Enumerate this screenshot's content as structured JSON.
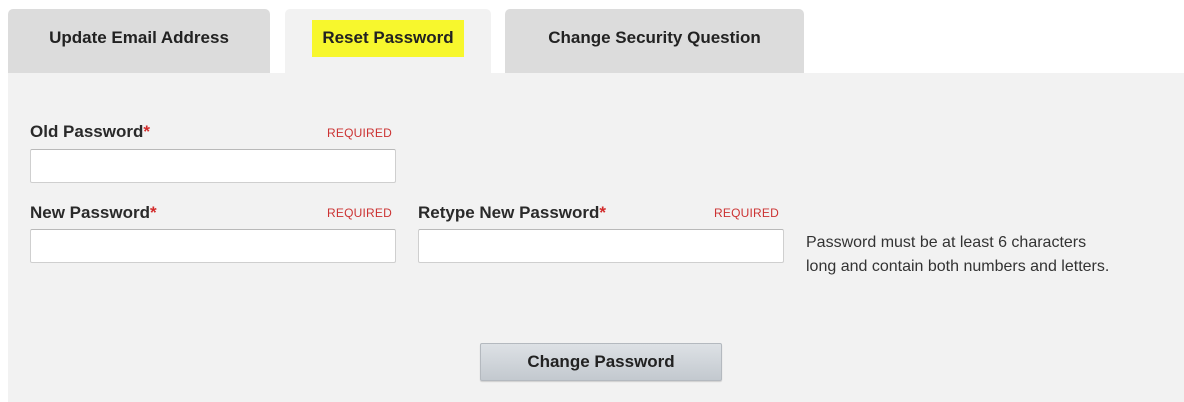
{
  "tabs": [
    {
      "label": "Update Email Address",
      "active": false
    },
    {
      "label": "Reset Password",
      "active": true
    },
    {
      "label": "Change Security Question",
      "active": false
    }
  ],
  "form": {
    "old_password": {
      "label": "Old Password",
      "required_marker": "*",
      "required_tag": "REQUIRED",
      "value": ""
    },
    "new_password": {
      "label": "New Password",
      "required_marker": "*",
      "required_tag": "REQUIRED",
      "value": ""
    },
    "retype_password": {
      "label": "Retype New Password",
      "required_marker": "*",
      "required_tag": "REQUIRED",
      "value": ""
    },
    "hint_line1": "Password must be at least 6 characters",
    "hint_line2": "long and contain both numbers and letters.",
    "submit_label": "Change Password"
  },
  "colors": {
    "panel_background": "#f2f2f2",
    "tab_inactive": "#dcdcdc",
    "active_highlight": "#f7f72d",
    "required_red": "#cc3333"
  }
}
